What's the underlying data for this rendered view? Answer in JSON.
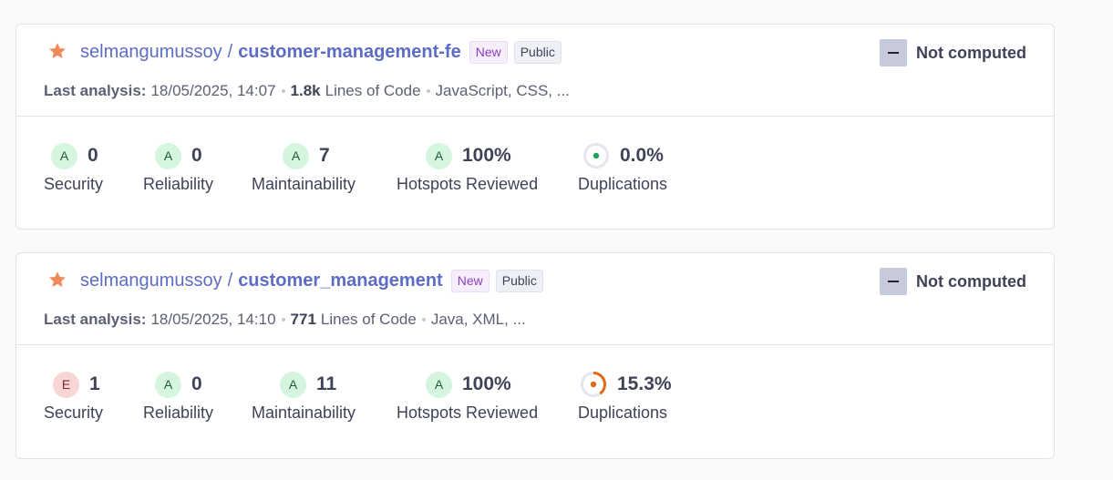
{
  "projects": [
    {
      "org": "selmangumussoy",
      "separator": "/",
      "name": "customer-management-fe",
      "badge_new": "New",
      "badge_public": "Public",
      "quality_gate": "Not computed",
      "last_analysis_label": "Last analysis:",
      "last_analysis_value": "18/05/2025, 14:07",
      "loc_value": "1.8k",
      "loc_label": "Lines of Code",
      "languages": "JavaScript, CSS, ...",
      "measures": {
        "security": {
          "rating": "A",
          "value": "0",
          "label": "Security"
        },
        "reliability": {
          "rating": "A",
          "value": "0",
          "label": "Reliability"
        },
        "maintainability": {
          "rating": "A",
          "value": "7",
          "label": "Maintainability"
        },
        "hotspots": {
          "rating": "A",
          "value": "100%",
          "label": "Hotspots Reviewed"
        },
        "duplications": {
          "value": "0.0%",
          "label": "Duplications",
          "fraction": 0.0,
          "color": "#1fa35a"
        }
      }
    },
    {
      "org": "selmangumussoy",
      "separator": "/",
      "name": "customer_management",
      "badge_new": "New",
      "badge_public": "Public",
      "quality_gate": "Not computed",
      "last_analysis_label": "Last analysis:",
      "last_analysis_value": "18/05/2025, 14:10",
      "loc_value": "771",
      "loc_label": "Lines of Code",
      "languages": "Java, XML, ...",
      "measures": {
        "security": {
          "rating": "E",
          "value": "1",
          "label": "Security"
        },
        "reliability": {
          "rating": "A",
          "value": "0",
          "label": "Reliability"
        },
        "maintainability": {
          "rating": "A",
          "value": "11",
          "label": "Maintainability"
        },
        "hotspots": {
          "rating": "A",
          "value": "100%",
          "label": "Hotspots Reviewed"
        },
        "duplications": {
          "value": "15.3%",
          "label": "Duplications",
          "fraction": 0.4,
          "color": "#e06a17"
        }
      }
    }
  ],
  "colors": {
    "link": "#5d6cc4",
    "star": "#ef8a5a",
    "rating_a_bg": "#d6f5df",
    "rating_e_bg": "#f9d6d6"
  }
}
